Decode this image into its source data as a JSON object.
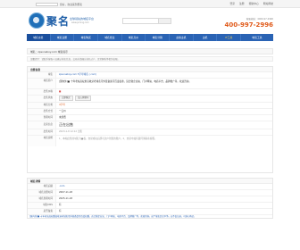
{
  "topbar": {
    "links": [
      "您好，欢迎来到聚名",
      "登录",
      "注册",
      "帮助中心",
      "网站导航"
    ]
  },
  "header": {
    "brand": "聚名",
    "slogan": "全球领先的域名平台",
    "slogan_sub": "www.juming.com",
    "search_placeholder": "",
    "contact_label": "客服热线：4000-97-2996",
    "phone": "400-997-2996"
  },
  "nav": {
    "items": [
      "域名交易",
      "域名注册",
      "域名购买",
      "域名抢注",
      "域名竞价",
      "域名分销",
      "虚拟主机",
      "主机",
      "IT工具",
      "域名工具"
    ],
    "right_label": "管理中心"
  },
  "breadcrumb": "域名：zpsoneboy.com 域名提示",
  "notice": "温馨提示：请联系客服人员确认域名信息，交易前请确认域名过户、正常解析等相关权限。",
  "sale_section": {
    "title": "出售信息",
    "rows": [
      {
        "label": "域名",
        "value": "zpsoneboy.com 5字母域名 (.com)",
        "style": "blue"
      },
      {
        "label": "域名简介",
        "value": "[国内外]■ 十年老站高权重高收录老域名带外链备案带百度权重，适合做企业站、门户网站、电商平台、品牌推广等，欢迎咨询。",
        "style": "tall"
      },
      {
        "label": "出售价格",
        "value": "■",
        "style": "red"
      },
      {
        "label": "出售状态",
        "value": "立即购买",
        "btn2": "加入购物车",
        "style": "btn"
      },
      {
        "label": "域名分类",
        "value": "4字母",
        "style": "orange"
      },
      {
        "label": "出售方式",
        "value": "一口价",
        "style": "plain"
      },
      {
        "label": "到期时间",
        "value": "未续费",
        "style": "plain"
      },
      {
        "label": "卖家信息",
        "value": "正在出售",
        "style": "big"
      },
      {
        "label": "出售时间",
        "value": "2023-1-8 12:12 出售",
        "style": "plain"
      },
      {
        "label": "域名说明",
        "value": "1、本站出售的域名为■权，交易成功后即可过户到您的账户。2、交易中如有疑问请联系客服。",
        "style": "tall"
      }
    ]
  },
  "whois_section": {
    "title": "域名详情",
    "rows": [
      {
        "label": "域名后缀",
        "value": ".com",
        "style": "blue"
      },
      {
        "label": "域名注册时间",
        "value": "2007-11-18",
        "style": "plain"
      },
      {
        "label": "域名到期时间",
        "value": "2025-11-18",
        "style": "plain"
      },
      {
        "label": "域名DNS",
        "value": "有",
        "style": "plain"
      },
      {
        "label": "是否备案",
        "value": "有",
        "style": "plain"
      }
    ],
    "description": "[国内外]■ 十年老站高权重高收录老域名带外链备案带百度权重，适合做企业站、门户网站、电商平台、品牌推广等，欢迎咨询。这个域名历史干净，无不良记录，可放心购买。"
  }
}
